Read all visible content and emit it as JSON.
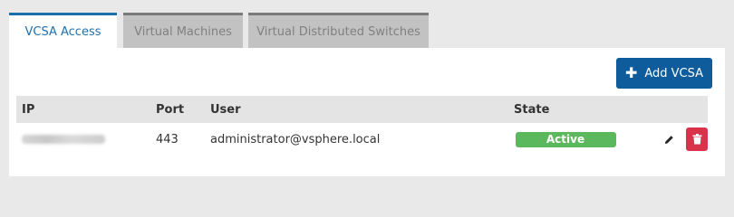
{
  "tabs": [
    {
      "label": "VCSA Access",
      "active": true
    },
    {
      "label": "Virtual Machines",
      "active": false
    },
    {
      "label": "Virtual Distributed Switches",
      "active": false
    }
  ],
  "toolbar": {
    "add_label": "Add VCSA",
    "add_icon": "plus-icon",
    "button_color": "#0e5c9c"
  },
  "table": {
    "columns": [
      "IP",
      "Port",
      "User",
      "State"
    ],
    "rows": [
      {
        "ip": "",
        "port": "443",
        "user": "administrator@vsphere.local",
        "state": "Active",
        "state_color": "#5cb85c",
        "actions": [
          "pencil-icon",
          "trash-icon"
        ]
      }
    ]
  },
  "colors": {
    "accent": "#1b6fa8",
    "delete": "#d9334b"
  }
}
